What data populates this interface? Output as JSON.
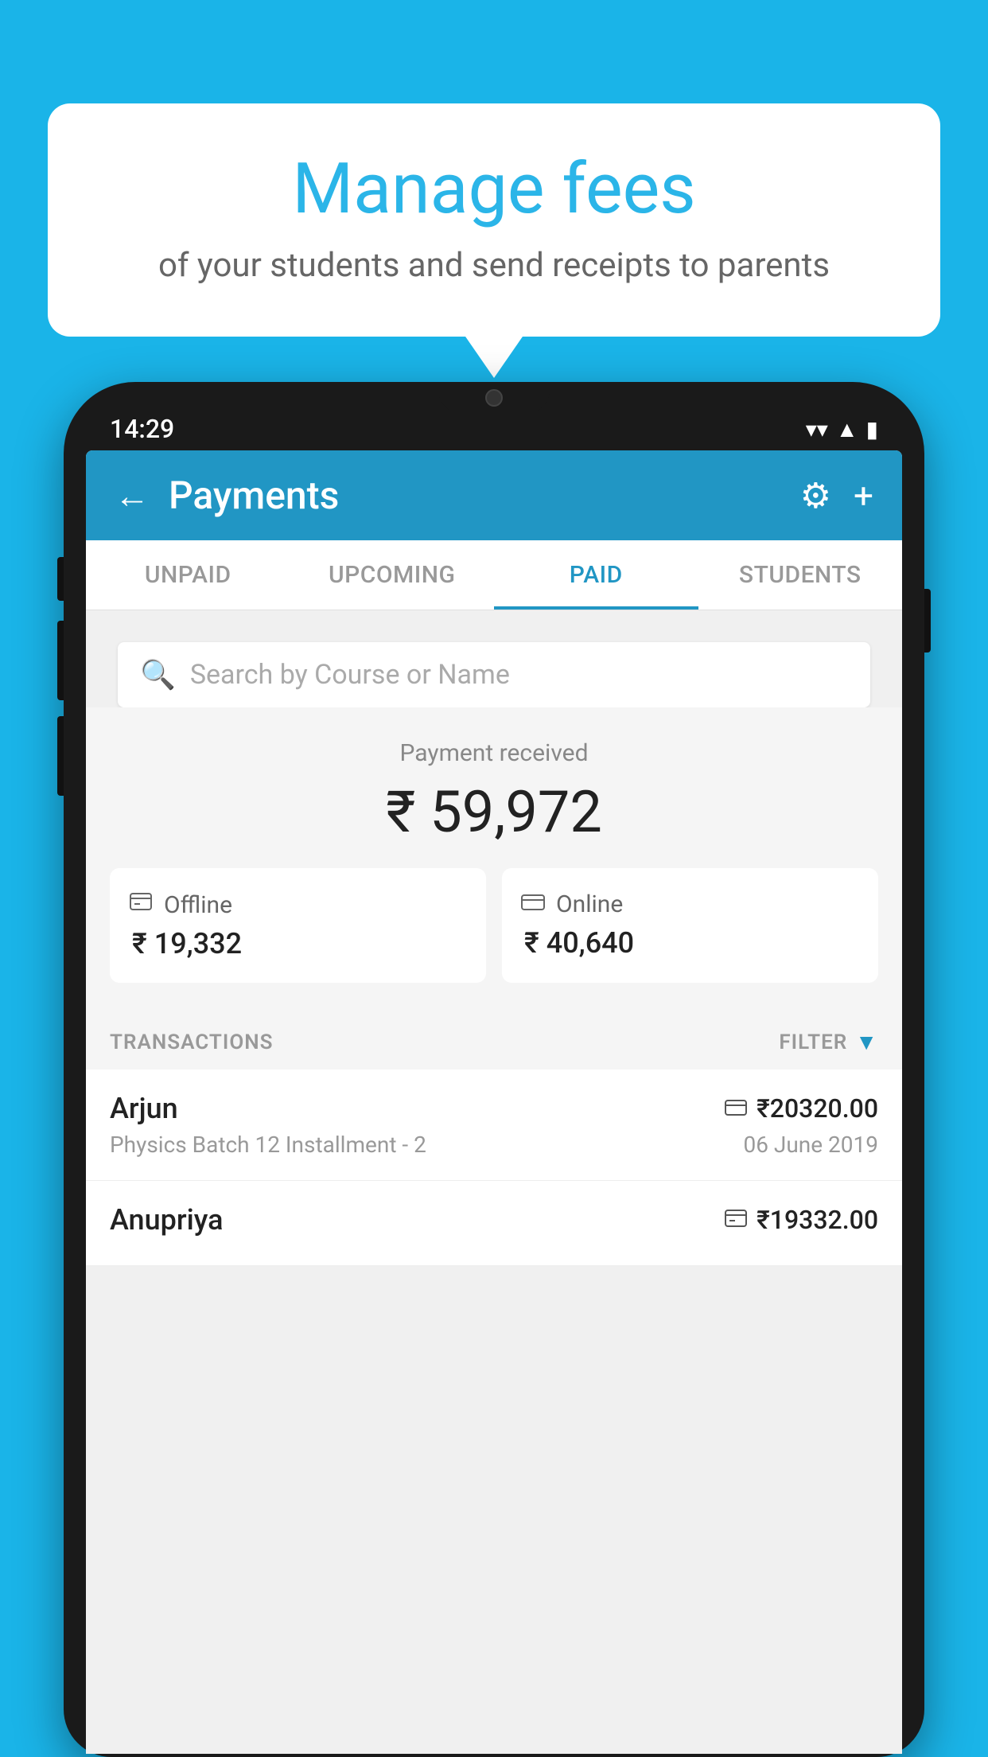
{
  "background_color": "#1ab4e8",
  "bubble": {
    "title": "Manage fees",
    "subtitle": "of your students and send receipts to parents"
  },
  "phone": {
    "status_bar": {
      "time": "14:29"
    },
    "header": {
      "title": "Payments",
      "back_label": "←",
      "settings_icon": "⚙",
      "add_icon": "+"
    },
    "tabs": [
      {
        "label": "UNPAID",
        "active": false
      },
      {
        "label": "UPCOMING",
        "active": false
      },
      {
        "label": "PAID",
        "active": true
      },
      {
        "label": "STUDENTS",
        "active": false
      }
    ],
    "search": {
      "placeholder": "Search by Course or Name"
    },
    "payment_summary": {
      "label": "Payment received",
      "amount": "₹ 59,972",
      "offline": {
        "label": "Offline",
        "amount": "₹ 19,332"
      },
      "online": {
        "label": "Online",
        "amount": "₹ 40,640"
      }
    },
    "transactions_section": {
      "label": "TRANSACTIONS",
      "filter_label": "FILTER"
    },
    "transactions": [
      {
        "name": "Arjun",
        "amount": "₹20320.00",
        "description": "Physics Batch 12 Installment - 2",
        "date": "06 June 2019",
        "payment_type": "card"
      },
      {
        "name": "Anupriya",
        "amount": "₹19332.00",
        "description": "",
        "date": "",
        "payment_type": "offline"
      }
    ]
  }
}
